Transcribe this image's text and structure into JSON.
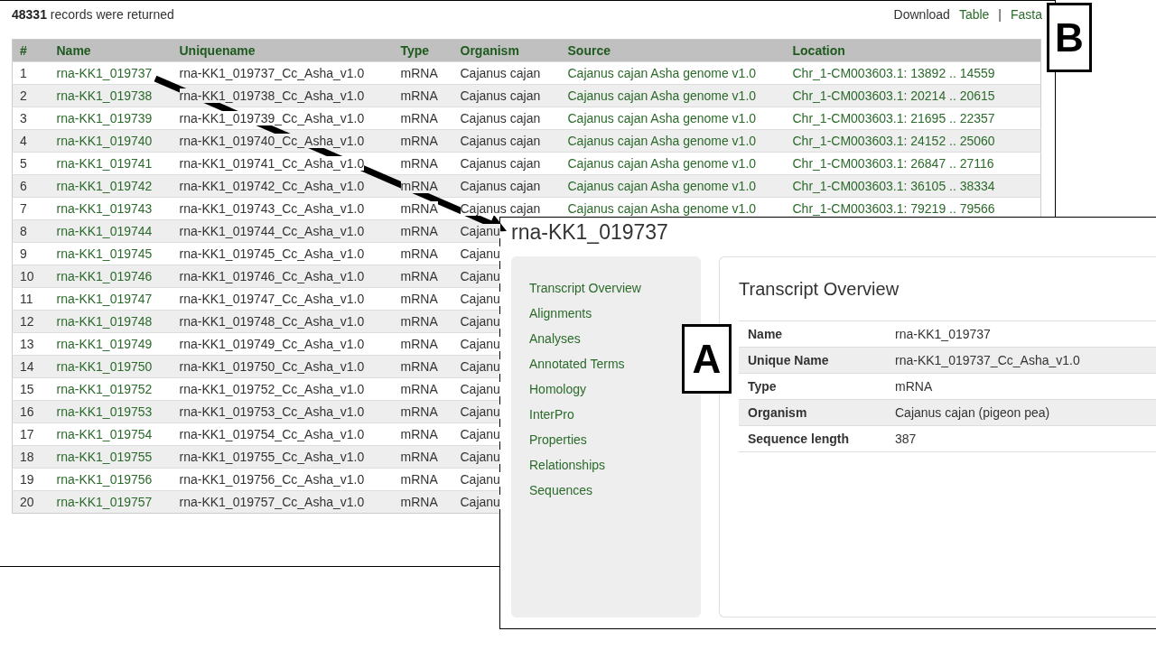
{
  "results": {
    "summary": "**48331** records were returned",
    "download_label": "Download",
    "download_links": [
      "Table",
      "Fasta"
    ],
    "separator": "|",
    "columns": [
      {
        "label": "#",
        "kind": "text"
      },
      {
        "label": "Name",
        "kind": "link"
      },
      {
        "label": "Uniquename",
        "kind": "text"
      },
      {
        "label": "Type",
        "kind": "text"
      },
      {
        "label": "Organism",
        "kind": "text"
      },
      {
        "label": "Source",
        "kind": "link"
      },
      {
        "label": "Location",
        "kind": "link"
      }
    ],
    "rows": [
      {
        "cells": [
          "1",
          "rna-KK1_019737",
          "rna-KK1_019737_Cc_Asha_v1.0",
          "mRNA",
          "Cajanus cajan",
          "Cajanus cajan Asha genome v1.0",
          "Chr_1-CM003603.1: 13892 .. 14559"
        ]
      },
      {
        "cells": [
          "2",
          "rna-KK1_019738",
          "rna-KK1_019738_Cc_Asha_v1.0",
          "mRNA",
          "Cajanus cajan",
          "Cajanus cajan Asha genome v1.0",
          "Chr_1-CM003603.1: 20214 .. 20615"
        ]
      },
      {
        "cells": [
          "3",
          "rna-KK1_019739",
          "rna-KK1_019739_Cc_Asha_v1.0",
          "mRNA",
          "Cajanus cajan",
          "Cajanus cajan Asha genome v1.0",
          "Chr_1-CM003603.1: 21695 .. 22357"
        ]
      },
      {
        "cells": [
          "4",
          "rna-KK1_019740",
          "rna-KK1_019740_Cc_Asha_v1.0",
          "mRNA",
          "Cajanus cajan",
          "Cajanus cajan Asha genome v1.0",
          "Chr_1-CM003603.1: 24152 .. 25060"
        ]
      },
      {
        "cells": [
          "5",
          "rna-KK1_019741",
          "rna-KK1_019741_Cc_Asha_v1.0",
          "mRNA",
          "Cajanus cajan",
          "Cajanus cajan Asha genome v1.0",
          "Chr_1-CM003603.1: 26847 .. 27116"
        ]
      },
      {
        "cells": [
          "6",
          "rna-KK1_019742",
          "rna-KK1_019742_Cc_Asha_v1.0",
          "mRNA",
          "Cajanus cajan",
          "Cajanus cajan Asha genome v1.0",
          "Chr_1-CM003603.1: 36105 .. 38334"
        ]
      },
      {
        "cells": [
          "7",
          "rna-KK1_019743",
          "rna-KK1_019743_Cc_Asha_v1.0",
          "mRNA",
          "Cajanus cajan",
          "Cajanus cajan Asha genome v1.0",
          "Chr_1-CM003603.1: 79219 .. 79566"
        ]
      },
      {
        "cells": [
          "8",
          "rna-KK1_019744",
          "rna-KK1_019744_Cc_Asha_v1.0",
          "mRNA",
          "Cajanu"
        ]
      },
      {
        "cells": [
          "9",
          "rna-KK1_019745",
          "rna-KK1_019745_Cc_Asha_v1.0",
          "mRNA",
          "Cajanu"
        ]
      },
      {
        "cells": [
          "10",
          "rna-KK1_019746",
          "rna-KK1_019746_Cc_Asha_v1.0",
          "mRNA",
          "Cajanu"
        ]
      },
      {
        "cells": [
          "11",
          "rna-KK1_019747",
          "rna-KK1_019747_Cc_Asha_v1.0",
          "mRNA",
          "Cajanu"
        ]
      },
      {
        "cells": [
          "12",
          "rna-KK1_019748",
          "rna-KK1_019748_Cc_Asha_v1.0",
          "mRNA",
          "Cajanu"
        ]
      },
      {
        "cells": [
          "13",
          "rna-KK1_019749",
          "rna-KK1_019749_Cc_Asha_v1.0",
          "mRNA",
          "Cajanu"
        ]
      },
      {
        "cells": [
          "14",
          "rna-KK1_019750",
          "rna-KK1_019750_Cc_Asha_v1.0",
          "mRNA",
          "Cajanu"
        ]
      },
      {
        "cells": [
          "15",
          "rna-KK1_019752",
          "rna-KK1_019752_Cc_Asha_v1.0",
          "mRNA",
          "Cajanu"
        ]
      },
      {
        "cells": [
          "16",
          "rna-KK1_019753",
          "rna-KK1_019753_Cc_Asha_v1.0",
          "mRNA",
          "Cajanu"
        ]
      },
      {
        "cells": [
          "17",
          "rna-KK1_019754",
          "rna-KK1_019754_Cc_Asha_v1.0",
          "mRNA",
          "Cajanu"
        ]
      },
      {
        "cells": [
          "18",
          "rna-KK1_019755",
          "rna-KK1_019755_Cc_Asha_v1.0",
          "mRNA",
          "Cajanu"
        ]
      },
      {
        "cells": [
          "19",
          "rna-KK1_019756",
          "rna-KK1_019756_Cc_Asha_v1.0",
          "mRNA",
          "Cajanu"
        ]
      },
      {
        "cells": [
          "20",
          "rna-KK1_019757",
          "rna-KK1_019757_Cc_Asha_v1.0",
          "mRNA",
          "Cajanu"
        ]
      }
    ]
  },
  "detail": {
    "title": "rna-KK1_019737",
    "nav": [
      "Transcript Overview",
      "Alignments",
      "Analyses",
      "Annotated Terms",
      "Homology",
      "InterPro",
      "Properties",
      "Relationships",
      "Sequences"
    ],
    "section_title": "Transcript Overview",
    "fields": [
      {
        "label": "Name",
        "value": "rna-KK1_019737"
      },
      {
        "label": "Unique Name",
        "value": "rna-KK1_019737_Cc_Asha_v1.0"
      },
      {
        "label": "Type",
        "value": "mRNA"
      },
      {
        "label": "Organism",
        "value": "Cajanus cajan (pigeon pea)"
      },
      {
        "label": "Sequence length",
        "value": "387"
      }
    ]
  },
  "callouts": [
    {
      "letter": "B"
    },
    {
      "letter": "A"
    }
  ]
}
